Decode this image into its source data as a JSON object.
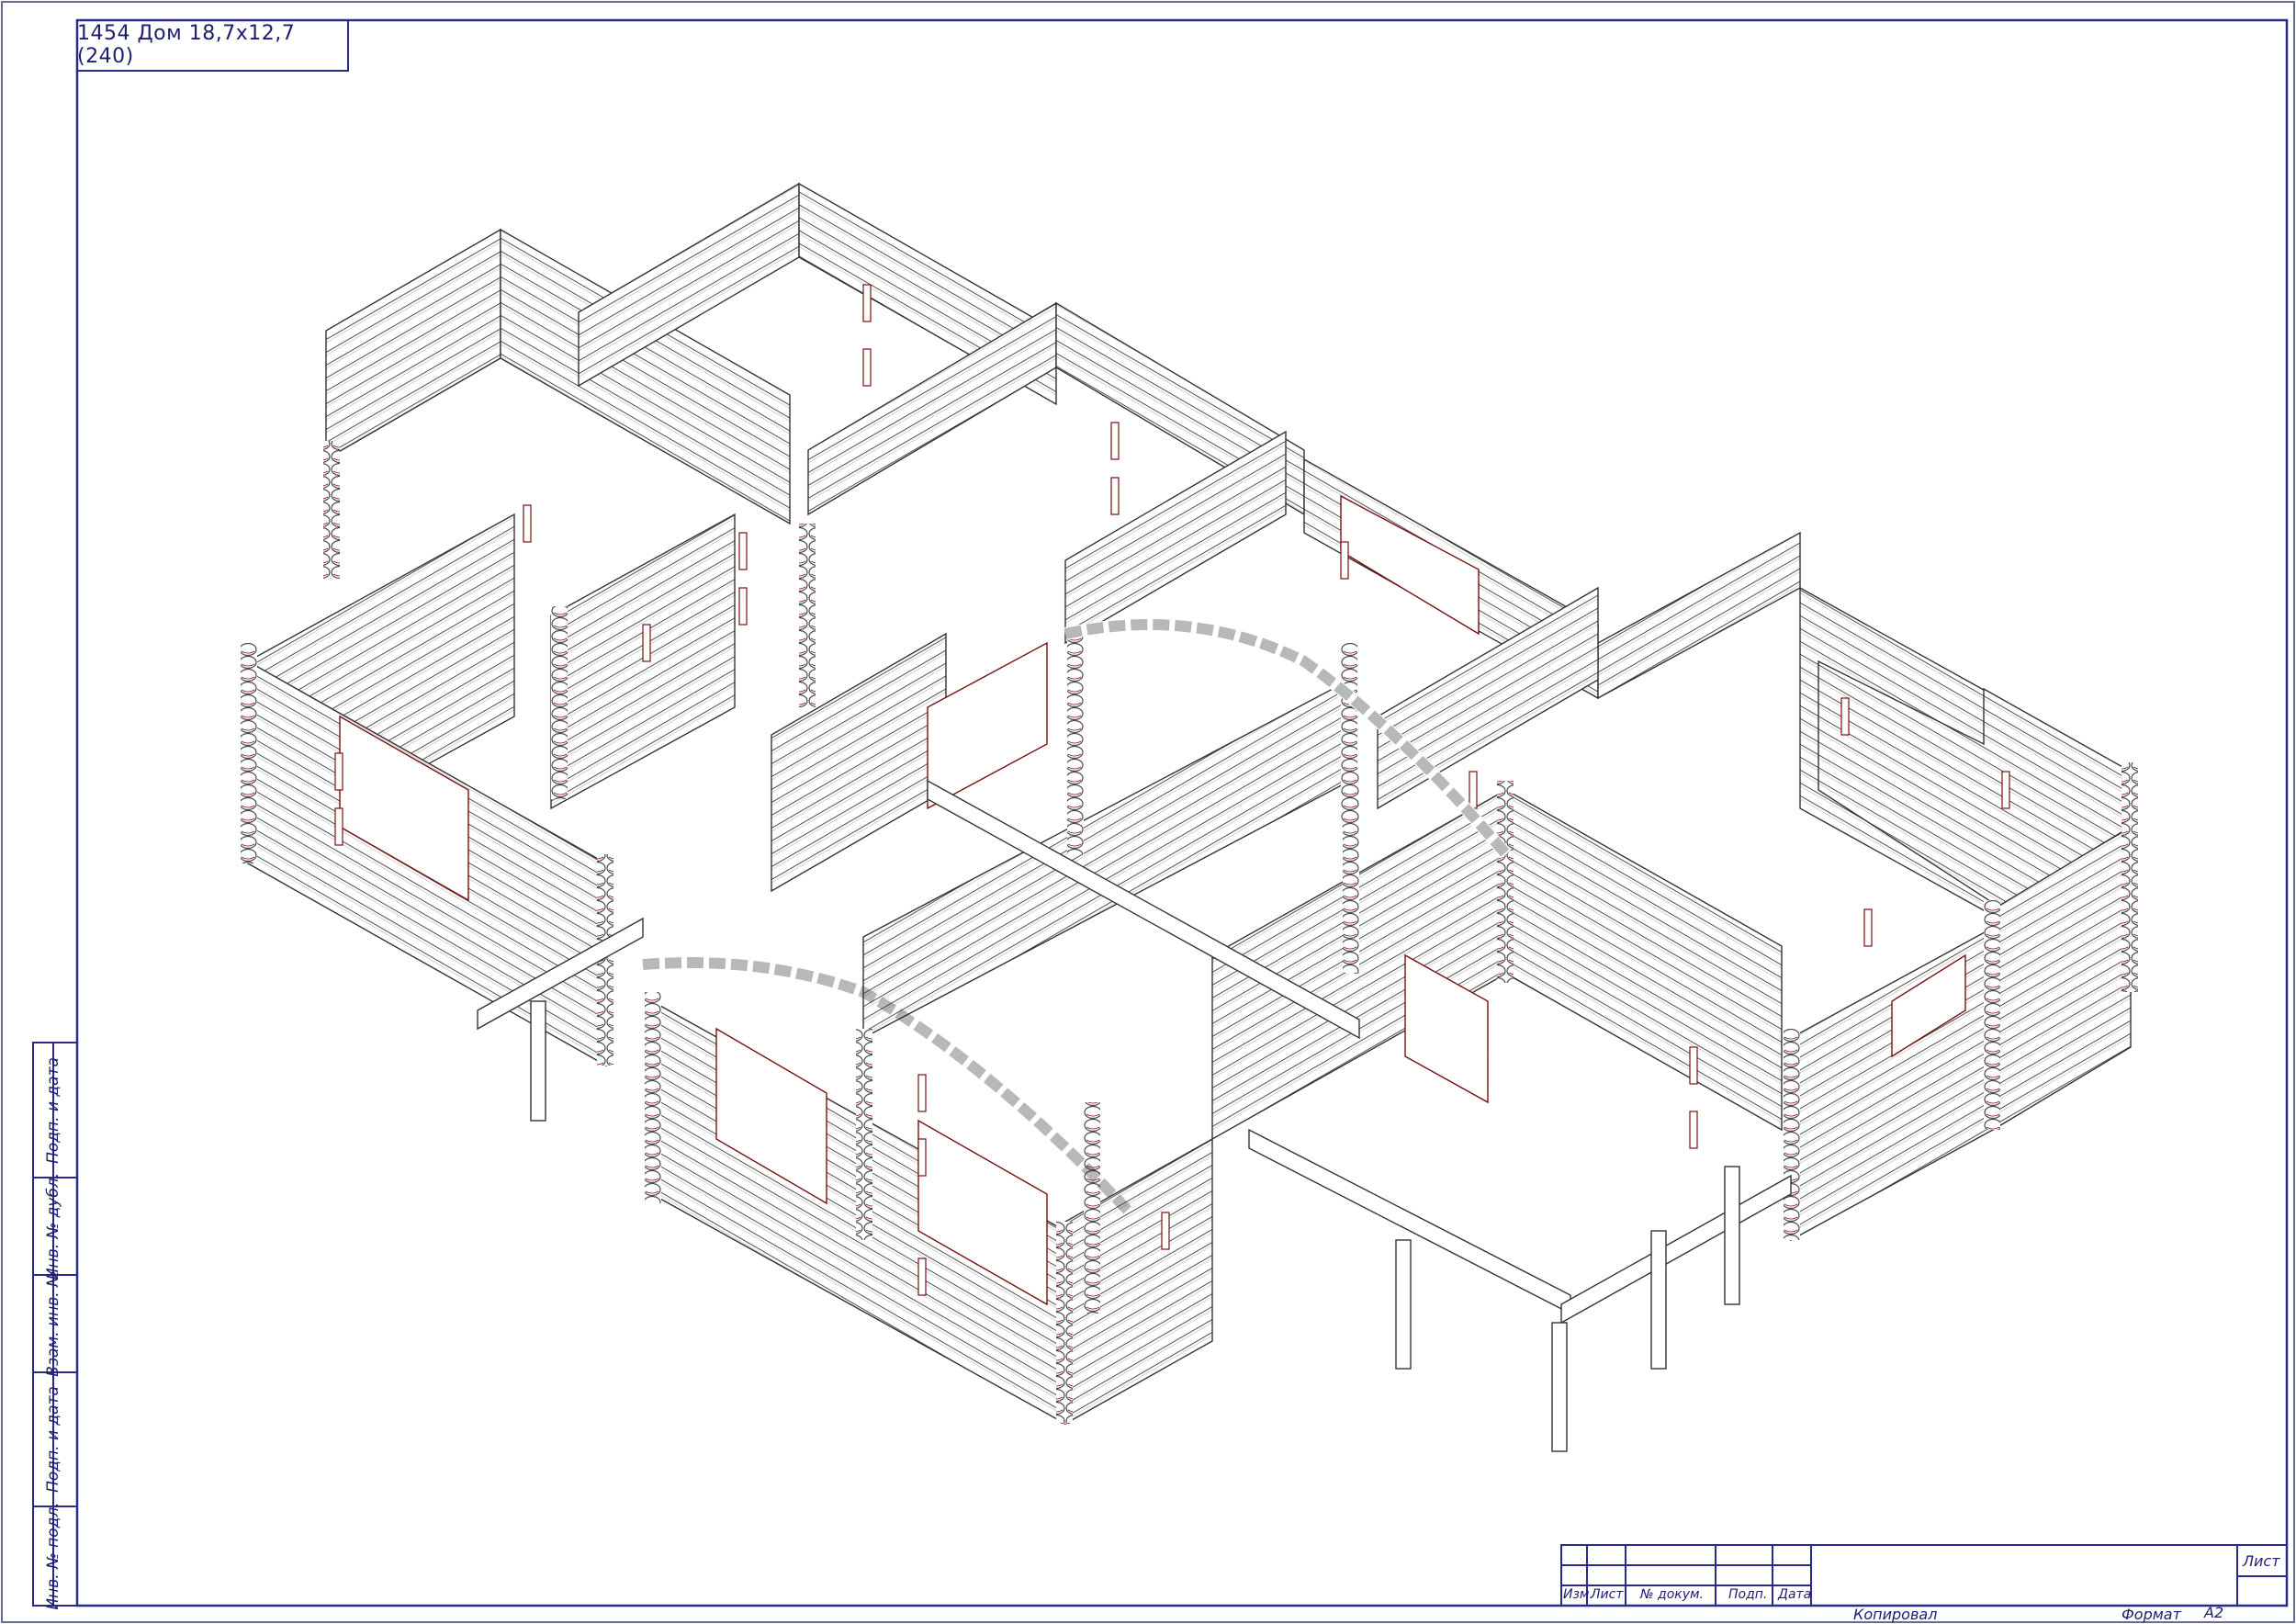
{
  "drawing": {
    "title": "1454 Дом 18,7x12,7 (240)"
  },
  "side_stamp": {
    "labels": [
      "Подп. и дата",
      "Инв. № дубл.",
      "Взам. инв. №",
      "Подп. и дата",
      "Инв. № подл."
    ]
  },
  "title_block": {
    "columns": [
      "Изм.",
      "Лист",
      "№ докум.",
      "Подп.",
      "Дата"
    ],
    "sheet_label": "Лист",
    "copied_label": "Копировал",
    "format_label": "Формат",
    "format_value": "А2"
  },
  "colors": {
    "frame": "#2a2a8a",
    "lines": "#3a3a3a",
    "accent": "#7a1010"
  }
}
